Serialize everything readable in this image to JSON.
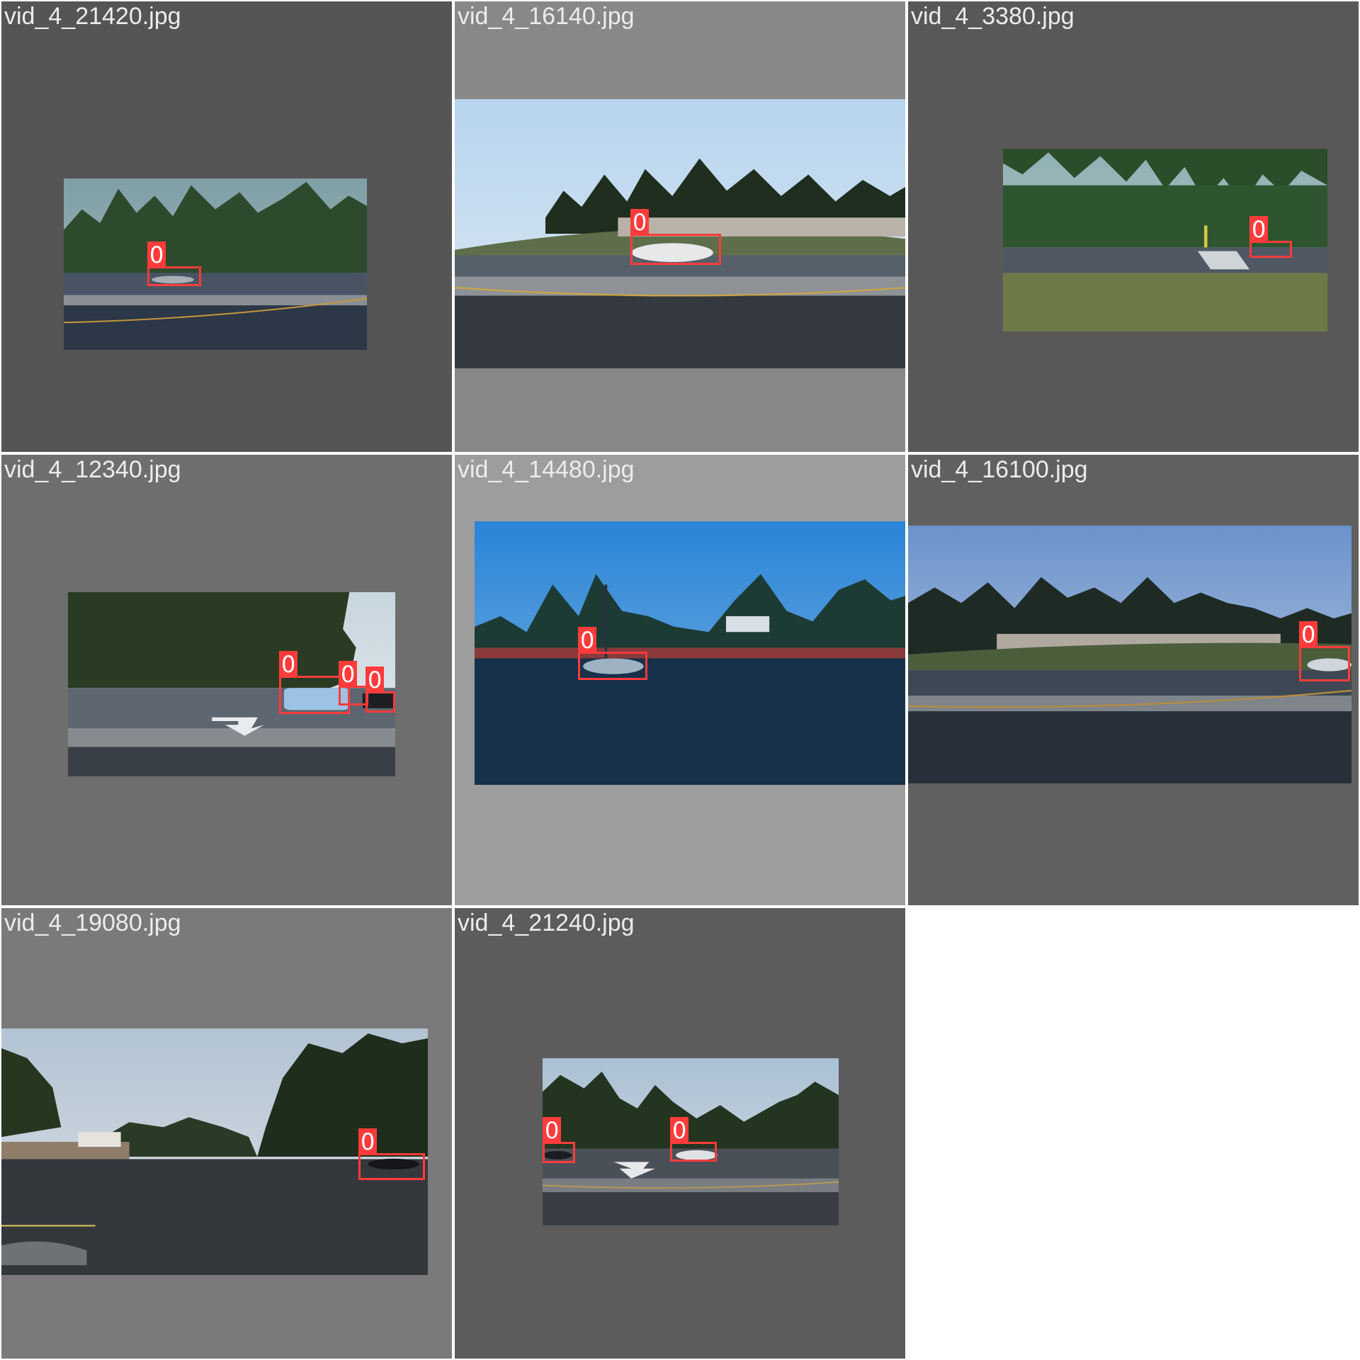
{
  "mosaic": {
    "tiles": [
      {
        "filename": "vid_4_21420.jpg",
        "boxes": [
          {
            "class_label": "0"
          }
        ]
      },
      {
        "filename": "vid_4_16140.jpg",
        "boxes": [
          {
            "class_label": "0"
          }
        ]
      },
      {
        "filename": "vid_4_3380.jpg",
        "boxes": [
          {
            "class_label": "0"
          }
        ]
      },
      {
        "filename": "vid_4_12340.jpg",
        "boxes": [
          {
            "class_label": "0"
          },
          {
            "class_label": "0"
          },
          {
            "class_label": "0"
          }
        ]
      },
      {
        "filename": "vid_4_14480.jpg",
        "boxes": [
          {
            "class_label": "0"
          }
        ]
      },
      {
        "filename": "vid_4_16100.jpg",
        "boxes": [
          {
            "class_label": "0"
          }
        ]
      },
      {
        "filename": "vid_4_19080.jpg",
        "boxes": [
          {
            "class_label": "0"
          }
        ]
      },
      {
        "filename": "vid_4_21240.jpg",
        "boxes": [
          {
            "class_label": "0",
            "side": "left"
          },
          {
            "class_label": "0",
            "side": "right"
          }
        ]
      }
    ]
  },
  "colors": {
    "box": "#ff3b3b",
    "label_text": "#ececec",
    "tile_backgrounds": [
      "#555555",
      "#888888",
      "#585858",
      "#6e6e6e",
      "#9d9d9d",
      "#606060",
      "#7a7a7a",
      "#5c5c5c"
    ]
  }
}
